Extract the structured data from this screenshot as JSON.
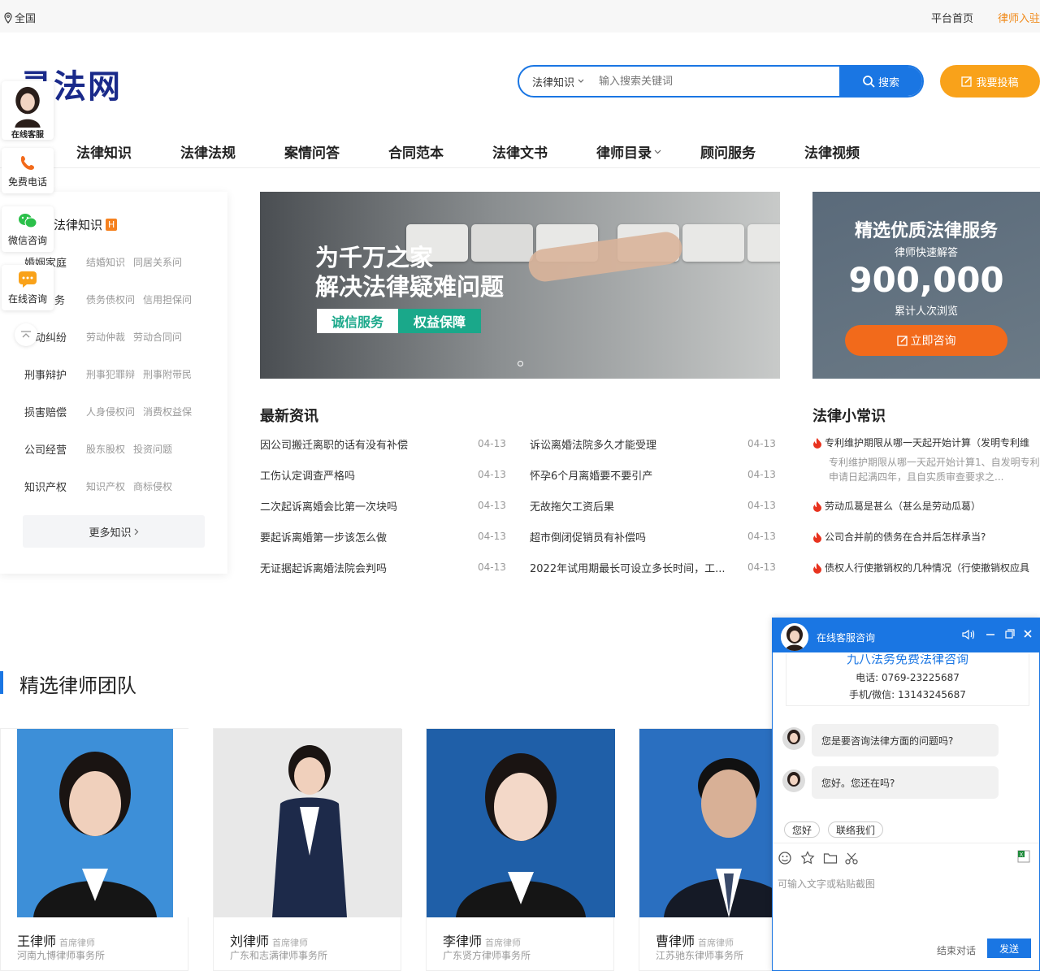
{
  "topbar": {
    "location": "全国",
    "home": "平台首页",
    "join": "律师入驻"
  },
  "logo": {
    "text": "寻法网"
  },
  "search": {
    "category": "法律知识",
    "placeholder": "输入搜索关键词",
    "button": "搜索"
  },
  "submit_label": "我要投稿",
  "nav": [
    "法律知识",
    "法律法规",
    "案情问答",
    "合同范本",
    "法律文书",
    "律师目录",
    "顾问服务",
    "法律视频"
  ],
  "float_buttons": {
    "kefu": "在线客服",
    "phone": "免费电话",
    "wechat": "微信咨询",
    "online": "在线咨询"
  },
  "categories": {
    "header": "法律知识",
    "header_badge": "H",
    "rows": [
      {
        "name": "婚姻家庭",
        "subs": [
          "结婚知识",
          "同居关系问"
        ]
      },
      {
        "name": "债务",
        "subs": [
          "债务债权问",
          "信用担保问"
        ]
      },
      {
        "name": "劳动纠纷",
        "subs": [
          "劳动仲裁",
          "劳动合同问"
        ]
      },
      {
        "name": "刑事辩护",
        "subs": [
          "刑事犯罪辩",
          "刑事附带民"
        ]
      },
      {
        "name": "损害赔偿",
        "subs": [
          "人身侵权问",
          "消费权益保"
        ]
      },
      {
        "name": "公司经营",
        "subs": [
          "股东股权",
          "投资问题"
        ]
      },
      {
        "name": "知识产权",
        "subs": [
          "知识产权",
          "商标侵权"
        ]
      }
    ],
    "more": "更多知识"
  },
  "banner": {
    "line1": "为千万之家",
    "line2": "解决法律疑难问题",
    "btn1": "诚信服务",
    "btn2": "权益保障"
  },
  "promo": {
    "title": "精选优质法律服务",
    "subtitle": "律师快速解答",
    "number": "900,000",
    "caption": "累计人次浏览",
    "button": "立即咨询"
  },
  "news": {
    "title": "最新资讯",
    "left": [
      {
        "title": "因公司搬迁离职的话有没有补偿",
        "date": "04-13"
      },
      {
        "title": "工伤认定调查严格吗",
        "date": "04-13"
      },
      {
        "title": "二次起诉离婚会比第一次块吗",
        "date": "04-13"
      },
      {
        "title": "要起诉离婚第一步该怎么做",
        "date": "04-13"
      },
      {
        "title": "无证据起诉离婚法院会判吗",
        "date": "04-13"
      }
    ],
    "right": [
      {
        "title": "诉讼离婚法院多久才能受理",
        "date": "04-13"
      },
      {
        "title": "怀孕6个月离婚要不要引产",
        "date": "04-13"
      },
      {
        "title": "无故拖欠工资后果",
        "date": "04-13"
      },
      {
        "title": "超市倒闭促销员有补偿吗",
        "date": "04-13"
      },
      {
        "title": "2022年试用期最长可设立多长时间，工...",
        "date": "04-13"
      }
    ]
  },
  "tips": {
    "title": "法律小常识",
    "items": [
      "专利维护期限从哪一天起开始计算（发明专利维",
      "劳动瓜葛是甚么（甚么是劳动瓜葛）",
      "公司合并前的债务在合并后怎样承当?",
      "债权人行使撤销权的几种情况（行使撤销权应具"
    ],
    "desc": "专利维护期限从哪一天起开始计算1、自发明专利申请日起满四年，且自实质审查要求之..."
  },
  "team": {
    "title": "精选律师团队",
    "lawyers": [
      {
        "name": "王律师",
        "rank": "首席律师",
        "firm": "河南九博律师事务所"
      },
      {
        "name": "刘律师",
        "rank": "首席律师",
        "firm": "广东和志满律师事务所"
      },
      {
        "name": "李律师",
        "rank": "首席律师",
        "firm": "广东贤方律师事务所"
      },
      {
        "name": "曹律师",
        "rank": "首席律师",
        "firm": "江苏驰东律师事务所"
      }
    ]
  },
  "chat": {
    "title": "在线客服咨询",
    "banner_title": "九八法务免费法律咨询",
    "phone": "电话:  0769-23225687",
    "mobile": "手机/微信:  13143245687",
    "msg1": "您是要咨询法律方面的问题吗?",
    "msg2": "您好。您还在吗?",
    "quick1": "您好",
    "quick2": "联络我们",
    "placeholder": "可输入文字或粘贴截图",
    "end": "结束对话",
    "send": "发送"
  },
  "colors": {
    "primary": "#1a76e3",
    "orange": "#f9a21a",
    "consult": "#f26a1b",
    "teal": "#1aa88a"
  }
}
